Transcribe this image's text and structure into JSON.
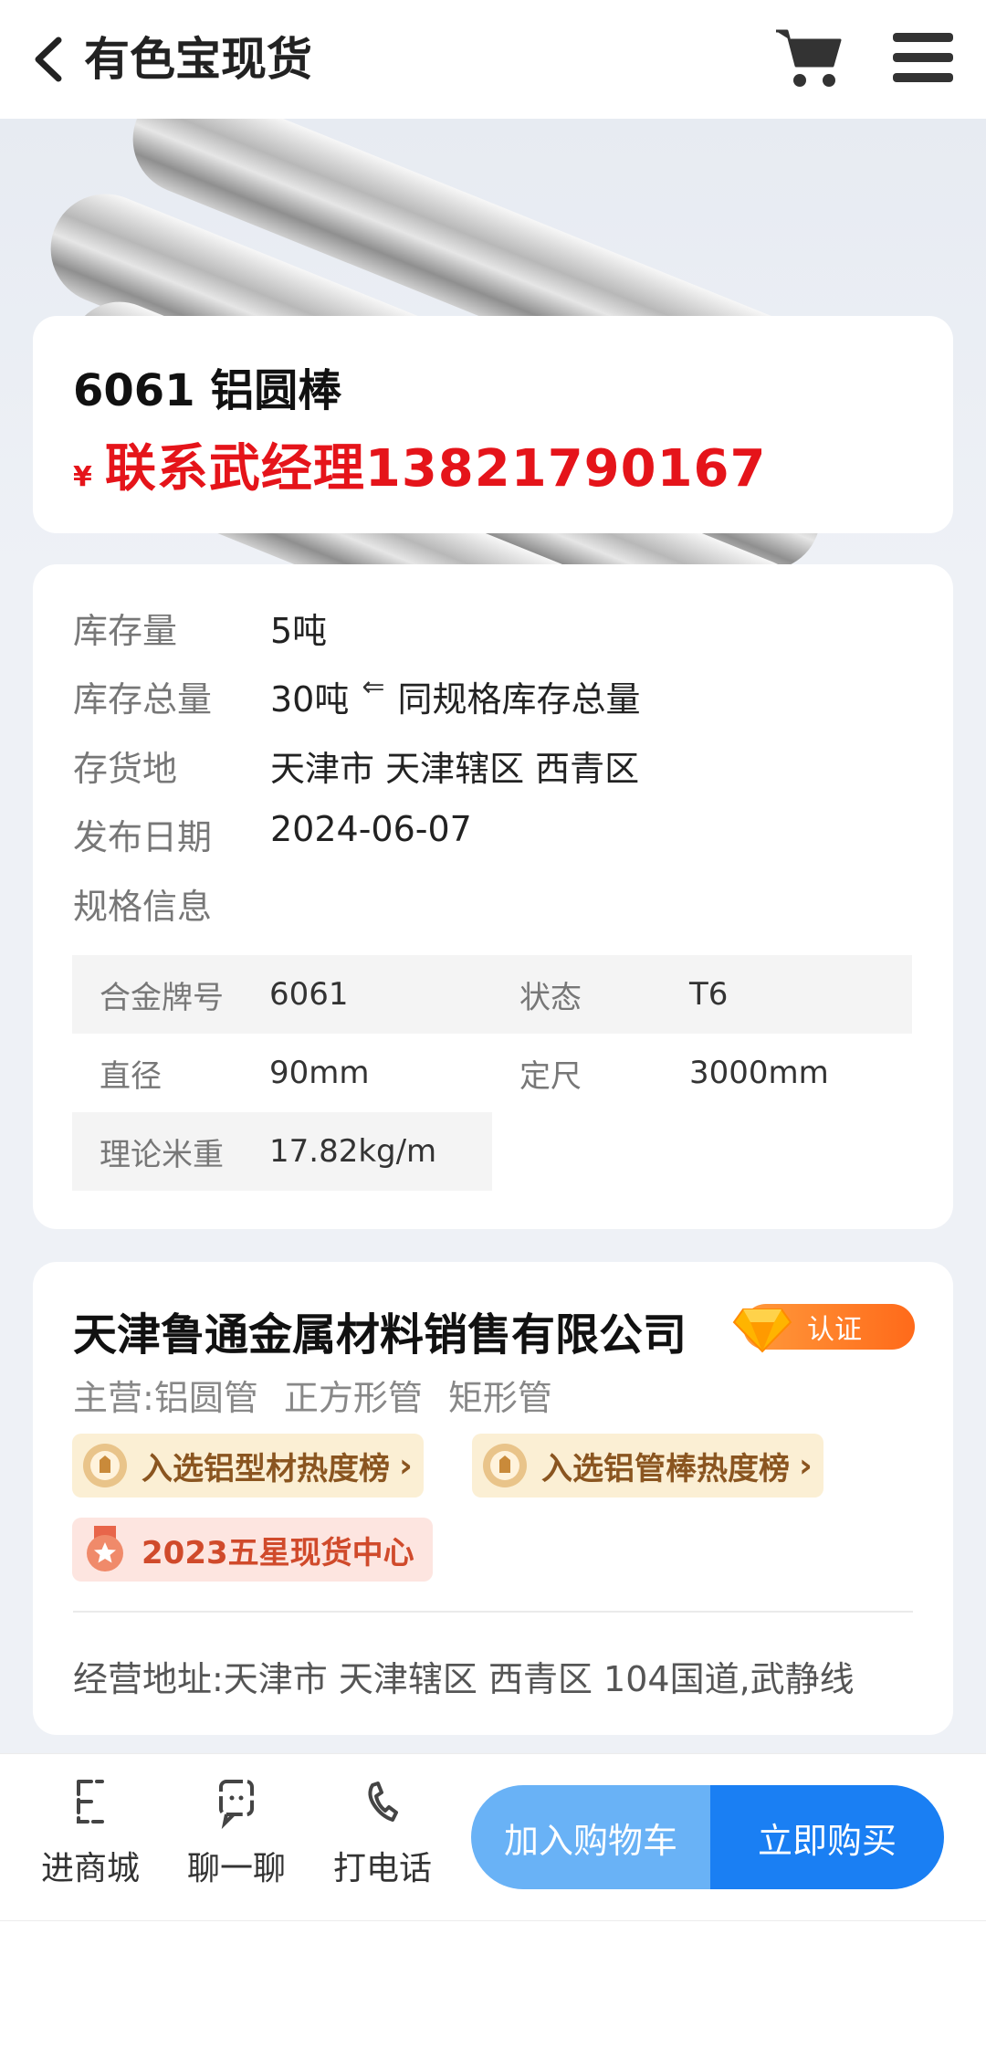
{
  "header": {
    "title": "有色宝现货",
    "back_icon": "chevron-left-icon",
    "cart_icon": "cart-icon",
    "menu_icon": "hamburger-menu-icon"
  },
  "product": {
    "name": "6061 铝圆棒",
    "currency_symbol": "¥",
    "price_text": "联系武经理13821790167"
  },
  "info": {
    "rows": [
      {
        "label": "库存量",
        "value": "5吨"
      },
      {
        "label": "库存总量",
        "value": "30吨",
        "arrow": "⇐",
        "note": "同规格库存总量"
      },
      {
        "label": "存货地",
        "value": "天津市 天津辖区 西青区"
      },
      {
        "label": "发布日期",
        "value": "2024-06-07"
      },
      {
        "label": "规格信息",
        "value": ""
      }
    ],
    "specs": [
      {
        "label": "合金牌号",
        "value": "6061"
      },
      {
        "label": "状态",
        "value": "T6"
      },
      {
        "label": "直径",
        "value": "90mm"
      },
      {
        "label": "定尺",
        "value": "3000mm"
      },
      {
        "label": "理论米重",
        "value": "17.82kg/m"
      }
    ]
  },
  "company": {
    "name": "天津鲁通金属材料销售有限公司",
    "badge": "认证",
    "main_label": "主营:",
    "main_items": [
      "铝圆管",
      "正方形管",
      "矩形管"
    ],
    "tags": [
      {
        "text": "入选铝型材热度榜",
        "chevron": "›"
      },
      {
        "text": "入选铝管棒热度榜",
        "chevron": "›"
      },
      {
        "text": "2023五星现货中心"
      }
    ],
    "address": "经营地址:天津市 天津辖区 西青区 104国道,武静线"
  },
  "colors": {
    "price_red": "#e5141a",
    "primary_blue": "#1a7ff3",
    "light_blue": "#69b2f6",
    "badge_orange": "#ff7a22"
  },
  "bottom_bar": {
    "nav": [
      {
        "label": "进商城",
        "icon": "store-icon"
      },
      {
        "label": "聊一聊",
        "icon": "chat-icon"
      },
      {
        "label": "打电话",
        "icon": "phone-icon"
      }
    ],
    "add_to_cart": "加入购物车",
    "buy_now": "立即购买"
  }
}
